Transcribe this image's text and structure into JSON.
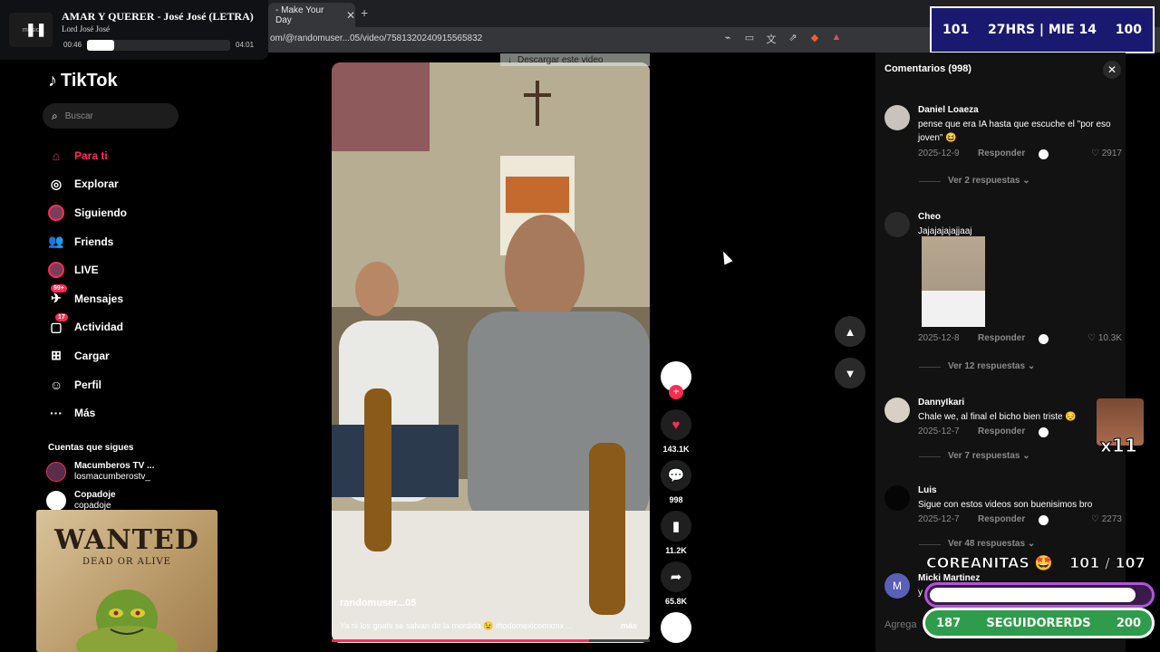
{
  "browser": {
    "tab_title": "- Make Your Day",
    "url": "om/@randomuser...05/video/7581320240915565832"
  },
  "player": {
    "thumb_label": "music",
    "song": "AMAR Y QUERER - José José (LETRA)",
    "artist": "Lord José José",
    "elapsed": "00:46",
    "total": "04:01",
    "progress": 0.19
  },
  "counter": {
    "left": "101",
    "center": "27HRS | MIE 14",
    "right": "100"
  },
  "sidebar": {
    "logo": "TikTok",
    "search_placeholder": "Buscar",
    "items": [
      {
        "label": "Para ti"
      },
      {
        "label": "Explorar"
      },
      {
        "label": "Siguiendo"
      },
      {
        "label": "Friends"
      },
      {
        "label": "LIVE"
      },
      {
        "label": "Mensajes",
        "badge": "99+"
      },
      {
        "label": "Actividad",
        "badge": "17"
      },
      {
        "label": "Cargar"
      },
      {
        "label": "Perfil"
      },
      {
        "label": "Más"
      }
    ],
    "following_title": "Cuentas que sigues",
    "following": [
      {
        "name": "Macumberos TV ...",
        "handle": "losmacumberostv_"
      },
      {
        "name": "Copadoje",
        "handle": "copadoje"
      }
    ]
  },
  "wanted": {
    "title": "WANTED",
    "subtitle": "DEAD OR ALIVE"
  },
  "video": {
    "download_label": "Descargar este video",
    "username": "randomuser...05",
    "caption": "Ya ni los goats se salvan de la mordida 😉 #todomexicomxmx ...",
    "more": "más",
    "progress": 0.81
  },
  "actions": {
    "likes": "143.1K",
    "comments": "998",
    "saves": "11.2K",
    "shares": "65.8K"
  },
  "comments_panel": {
    "title": "Comentarios (998)",
    "reply_label": "Responder",
    "add_placeholder": "Agrega",
    "comments": [
      {
        "name": "Daniel Loaeza",
        "text": "pense que era IA hasta que escuche el \"por eso joven\" 😆",
        "date": "2025-12-9",
        "likes": "2917",
        "more": "Ver 2 respuestas"
      },
      {
        "name": "Cheo",
        "text": "Jajajajajajjaaj",
        "date": "2025-12-8",
        "likes": "10.3K",
        "more": "Ver 12 respuestas"
      },
      {
        "name": "DannyIkari",
        "text": "Chale we, al final el bicho bien triste 😔",
        "date": "2025-12-7",
        "likes": "",
        "more": "Ver 7 respuestas"
      },
      {
        "name": "Luis",
        "text": "Sigue con estos videos son buenisimos bro",
        "date": "2025-12-7",
        "likes": "2273",
        "more": "Ver 48 respuestas"
      },
      {
        "name": "Micki Martinez",
        "text": "y",
        "date": "",
        "likes": "",
        "more": ""
      }
    ]
  },
  "stream": {
    "emote_multiplier": "x11",
    "coreanitas_label": "COREANITAS 🤩",
    "coreanitas_count": "101  / 107",
    "coreanitas_progress": 0.94,
    "followers_left": "187",
    "followers_label": "SEGUIDORERDS",
    "followers_right": "200"
  },
  "colors": {
    "accent": "#fe2c55",
    "panel": "#121212",
    "counter_bg": "#1a1970",
    "followers_bar": "#2e9c4a",
    "coreanitas_bar": "#b155d8"
  }
}
